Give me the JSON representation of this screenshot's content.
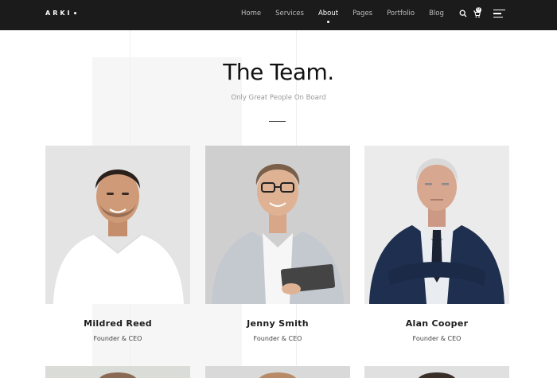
{
  "header": {
    "logo": "ARKI",
    "nav": [
      {
        "label": "Home"
      },
      {
        "label": "Services"
      },
      {
        "label": "About",
        "active": true
      },
      {
        "label": "Pages"
      },
      {
        "label": "Portfolio"
      },
      {
        "label": "Blog"
      }
    ],
    "cart_count": "0",
    "icons": [
      "search-icon",
      "cart-icon",
      "menu-icon"
    ]
  },
  "section": {
    "title": "The Team.",
    "subtitle": "Only Great People On Board"
  },
  "team": [
    {
      "name": "Mildred Reed",
      "role": "Founder & CEO"
    },
    {
      "name": "Jenny Smith",
      "role": "Founder & CEO"
    },
    {
      "name": "Alan Cooper",
      "role": "Founder & CEO"
    }
  ],
  "colors": {
    "header_bg": "#1b1b1b",
    "text_dark": "#111111",
    "subtitle": "#9a9a9a",
    "panel_bg": "#f6f6f6"
  }
}
